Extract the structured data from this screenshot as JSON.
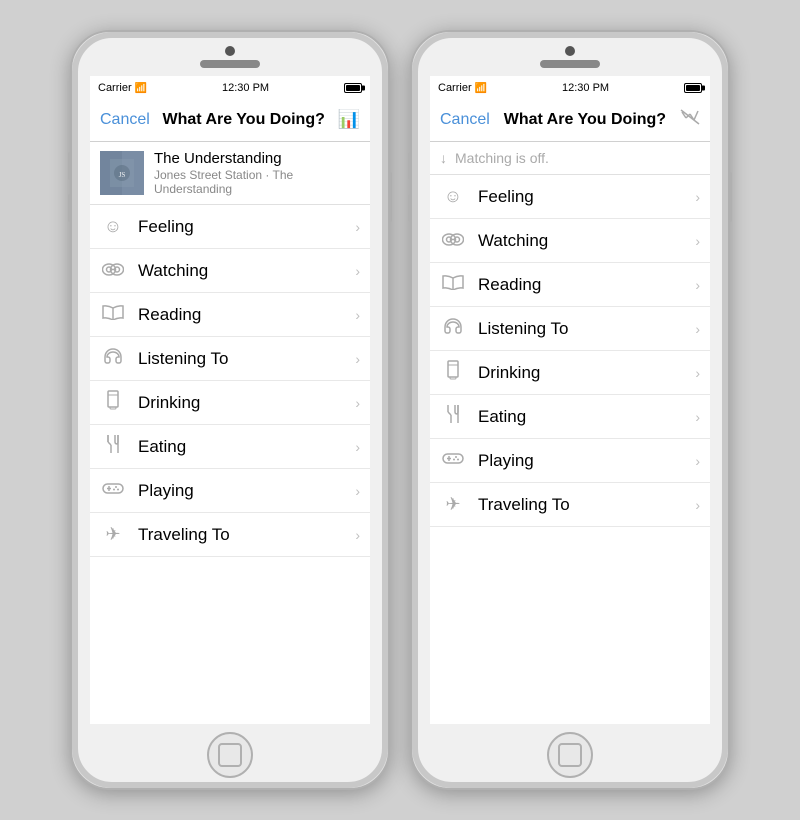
{
  "phone1": {
    "statusBar": {
      "carrier": "Carrier",
      "time": "12:30 PM"
    },
    "navBar": {
      "cancel": "Cancel",
      "title": "What Are You Doing?",
      "iconLabel": "chart-icon"
    },
    "musicItem": {
      "title": "The Understanding",
      "subtitle": "Jones Street Station · The Understanding"
    },
    "listItems": [
      {
        "icon": "😊",
        "label": "Feeling"
      },
      {
        "icon": "👓",
        "label": "Watching"
      },
      {
        "icon": "📖",
        "label": "Reading"
      },
      {
        "icon": "🎧",
        "label": "Listening To"
      },
      {
        "icon": "🥛",
        "label": "Drinking"
      },
      {
        "icon": "🍴",
        "label": "Eating"
      },
      {
        "icon": "🎮",
        "label": "Playing"
      },
      {
        "icon": "✈",
        "label": "Traveling To"
      }
    ]
  },
  "phone2": {
    "statusBar": {
      "carrier": "Carrier",
      "time": "12:30 PM"
    },
    "navBar": {
      "cancel": "Cancel",
      "title": "What Are You Doing?",
      "iconLabel": "chart-disabled-icon"
    },
    "matchingOff": "Matching is off.",
    "listItems": [
      {
        "icon": "😊",
        "label": "Feeling"
      },
      {
        "icon": "👓",
        "label": "Watching"
      },
      {
        "icon": "📖",
        "label": "Reading"
      },
      {
        "icon": "🎧",
        "label": "Listening To"
      },
      {
        "icon": "🥛",
        "label": "Drinking"
      },
      {
        "icon": "🍴",
        "label": "Eating"
      },
      {
        "icon": "🎮",
        "label": "Playing"
      },
      {
        "icon": "✈",
        "label": "Traveling To"
      }
    ]
  }
}
